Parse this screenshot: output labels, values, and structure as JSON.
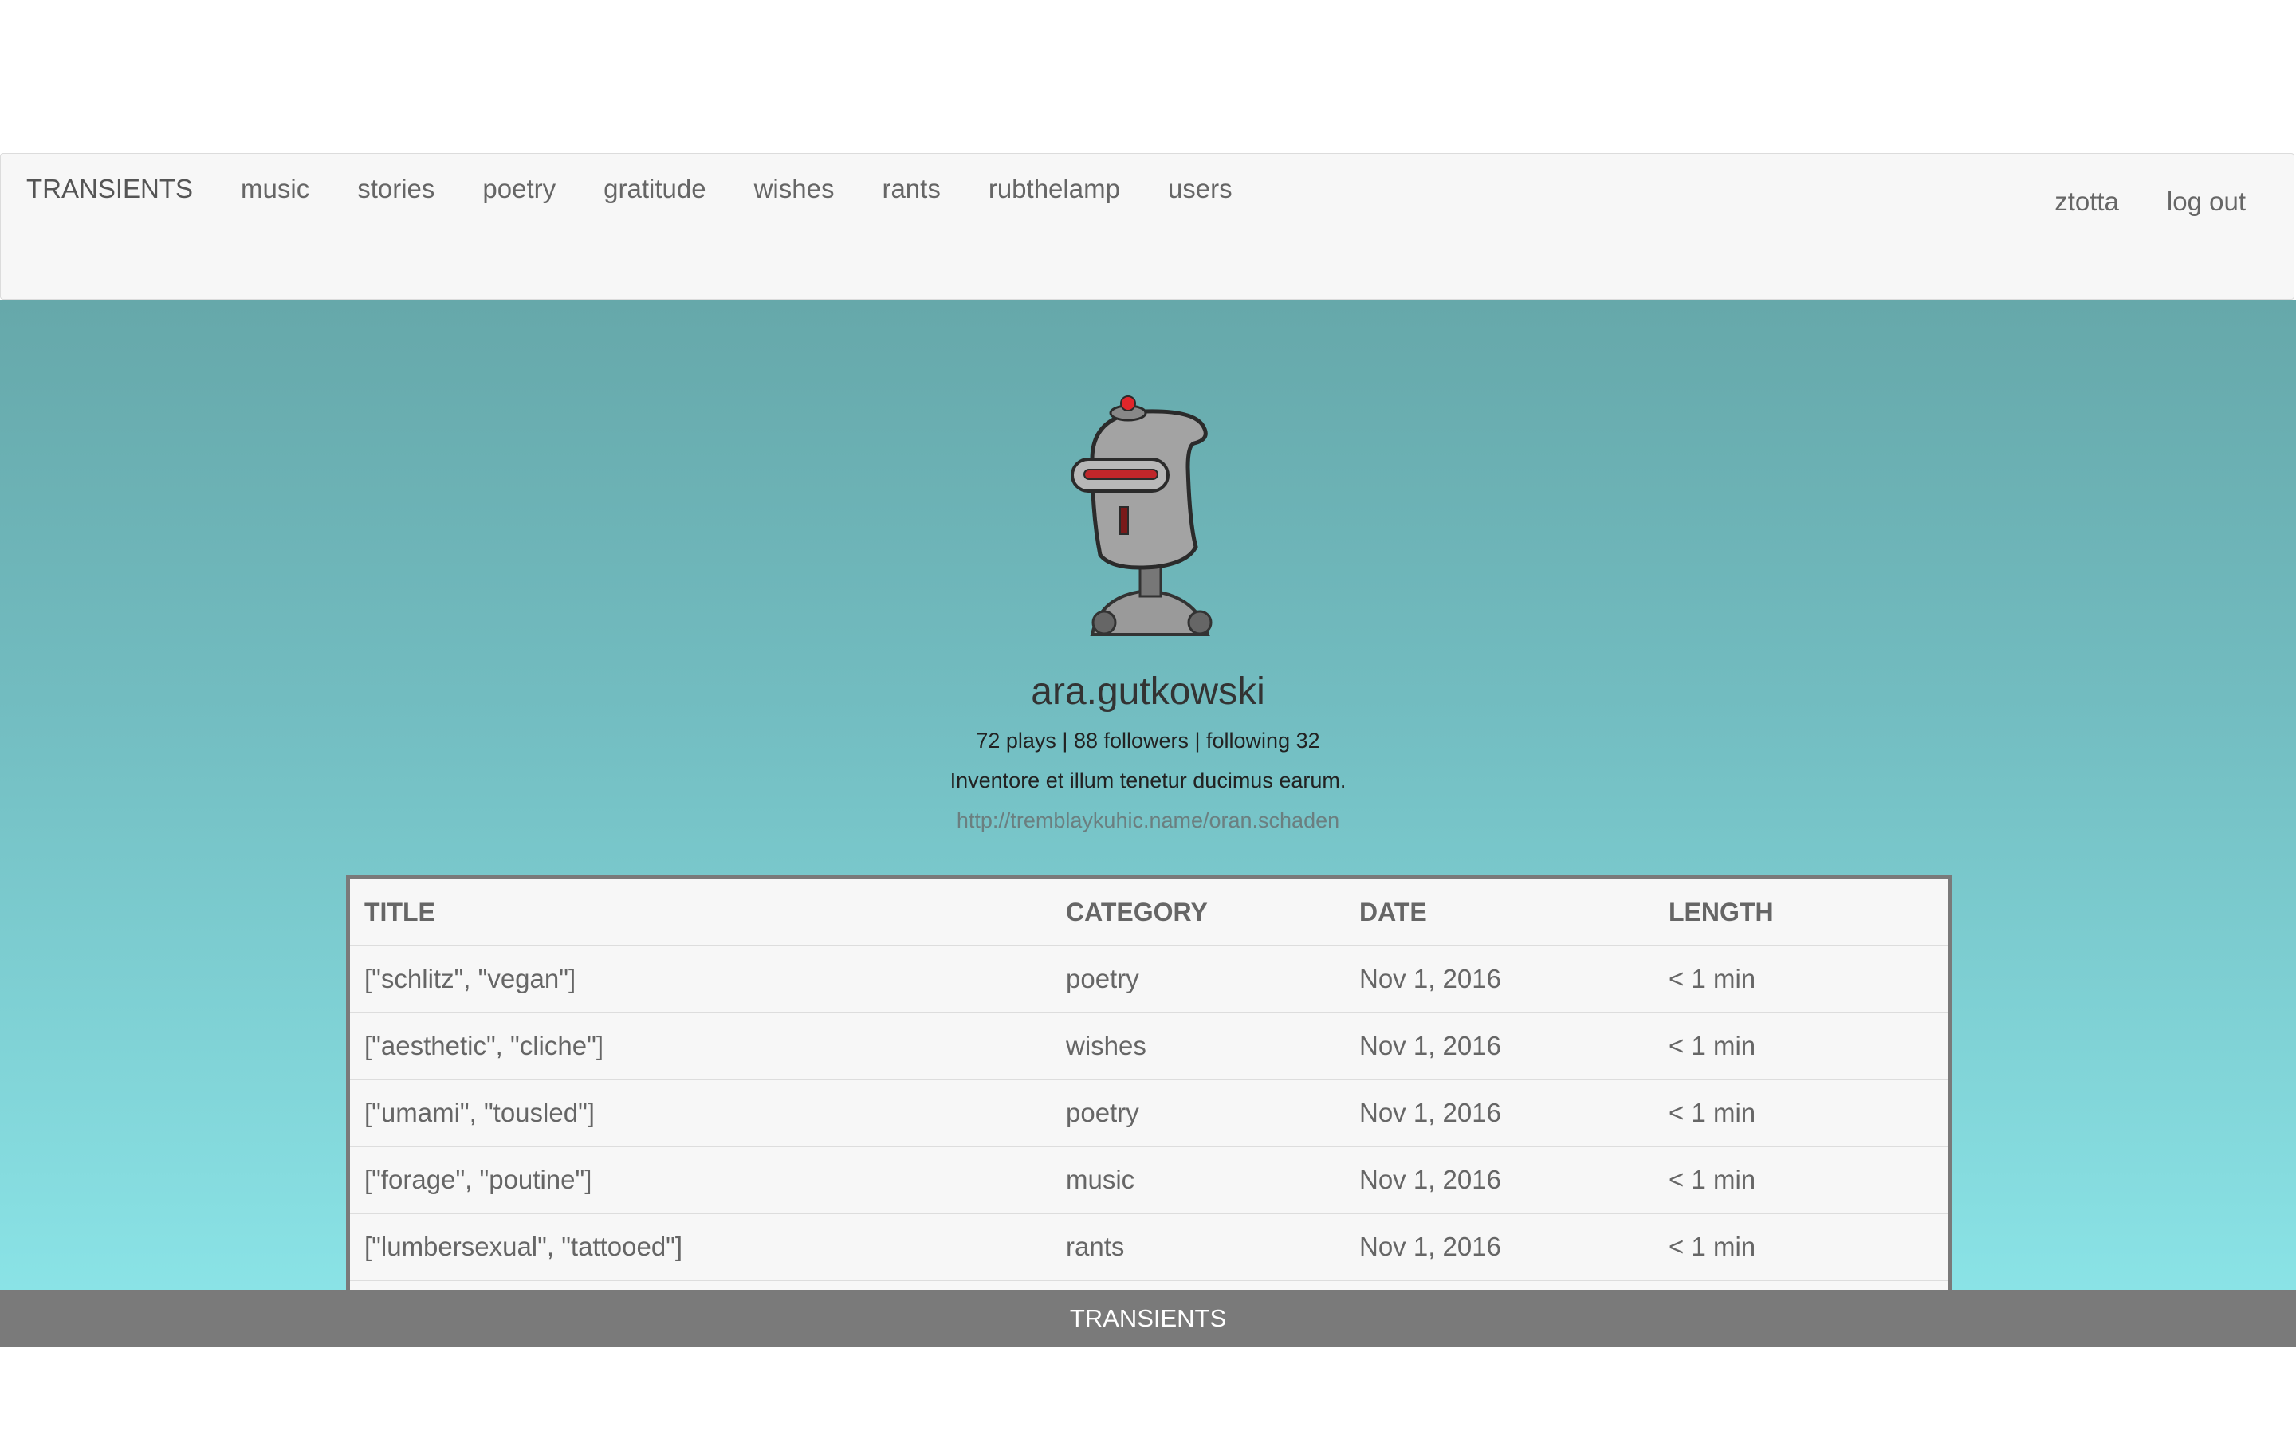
{
  "nav": {
    "brand": "TRANSIENTS",
    "items": [
      "music",
      "stories",
      "poetry",
      "gratitude",
      "wishes",
      "rants",
      "rubthelamp",
      "users"
    ],
    "right_items": [
      "ztotta",
      "log out"
    ]
  },
  "profile": {
    "avatar_icon": "robot-avatar-icon",
    "username": "ara.gutkowski",
    "stats": "72 plays | 88 followers | following 32",
    "bio": "Inventore et illum tenetur ducimus earum.",
    "link": "http://tremblaykuhic.name/oran.schaden"
  },
  "table": {
    "headers": [
      "TITLE",
      "CATEGORY",
      "DATE",
      "LENGTH"
    ],
    "rows": [
      [
        "[\"schlitz\", \"vegan\"]",
        "poetry",
        "Nov 1, 2016",
        "< 1 min"
      ],
      [
        "[\"aesthetic\", \"cliche\"]",
        "wishes",
        "Nov 1, 2016",
        "< 1 min"
      ],
      [
        "[\"umami\", \"tousled\"]",
        "poetry",
        "Nov 1, 2016",
        "< 1 min"
      ],
      [
        "[\"forage\", \"poutine\"]",
        "music",
        "Nov 1, 2016",
        "< 1 min"
      ],
      [
        "[\"lumbersexual\", \"tattooed\"]",
        "rants",
        "Nov 1, 2016",
        "< 1 min"
      ]
    ]
  },
  "footer": {
    "label": "TRANSIENTS"
  },
  "colors": {
    "hero_top": "#66a8aa",
    "hero_bottom": "#8ae3e6",
    "navbar_bg": "#f7f7f7",
    "footer_bg": "#7a7a7a",
    "table_border": "#7a7a7a"
  }
}
